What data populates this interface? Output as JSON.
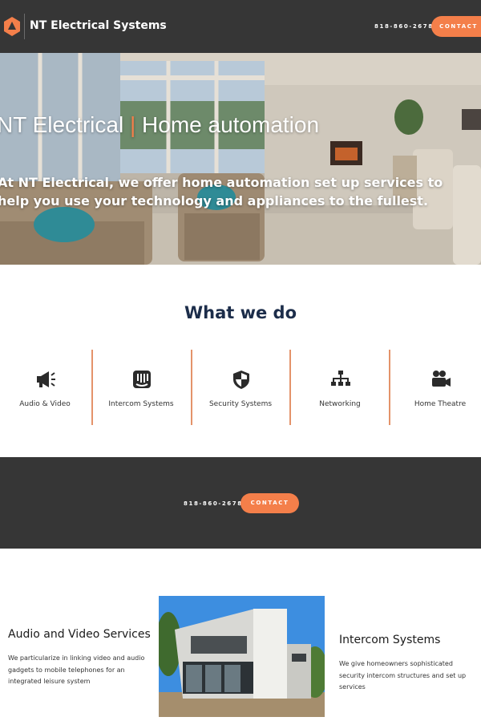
{
  "header": {
    "brand": "NT Electrical Systems",
    "phone": "818-860-2678",
    "contact_label": "CONTACT",
    "logo_icon": "nt-logo-icon"
  },
  "hero": {
    "title_part1": "NT Electrical",
    "title_separator": "|",
    "title_part2": "Home automation",
    "text": "At NT Electrical, we offer home automation set up services to help you use your technology and appliances to the fullest."
  },
  "what_we_do": {
    "title": "What we do",
    "services": [
      {
        "label": "Audio & Video",
        "icon": "megaphone-icon"
      },
      {
        "label": "Intercom Systems",
        "icon": "intercom-icon"
      },
      {
        "label": "Security Systems",
        "icon": "shield-icon"
      },
      {
        "label": "Networking",
        "icon": "network-icon"
      },
      {
        "label": "Home Theatre",
        "icon": "video-camera-icon"
      }
    ]
  },
  "cta": {
    "phone": "818-860-2678",
    "contact_label": "CONTACT"
  },
  "details": {
    "audio_video": {
      "title": "Audio and Video Services",
      "description": "We particularize in linking video and audio gadgets to mobile telephones for an integrated leisure system"
    },
    "intercom": {
      "title": "Intercom Systems",
      "description": "We give homeowners sophisticated security intercom structures and set up services"
    }
  },
  "colors": {
    "accent": "#f47f4a",
    "dark": "#363636",
    "heading": "#1c2d4a"
  }
}
